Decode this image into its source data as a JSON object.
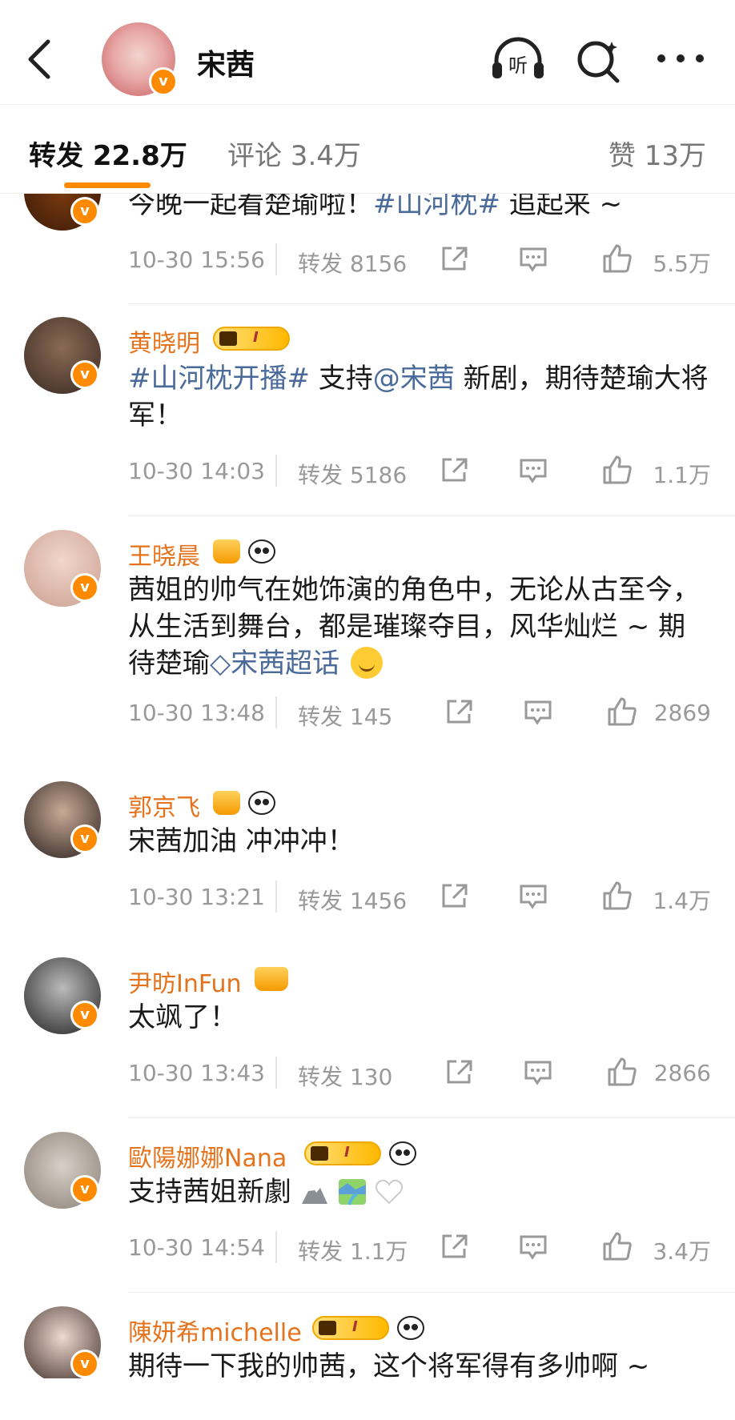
{
  "header": {
    "title": "宋茜"
  },
  "tabs": {
    "repost": "转发 22.8万",
    "comments": "评论 3.4万",
    "likes": "赞 13万"
  },
  "posts": [
    {
      "text": "今晚一起看楚瑜啦！",
      "link": "#山河枕#",
      "text2": " 追起来 ~",
      "time": "10-30 15:56",
      "reposts": "转发 8156",
      "likes": "5.5万"
    },
    {
      "name": "黄晓明",
      "link1": "#山河枕开播#",
      "text1": " 支持",
      "link2": "@宋茜",
      "text2": " 新剧，期待楚瑜大将军！",
      "time": "10-30 14:03",
      "reposts": "转发 5186",
      "likes": "1.1万"
    },
    {
      "name": "王晓晨",
      "text": "茜姐的帅气在她饰演的角色中，无论从古至今，从生活到舞台，都是璀璨夺目，风华灿烂 ~ 期待楚瑜",
      "link": "宋茜超话",
      "time": "10-30 13:48",
      "reposts": "转发 145",
      "likes": "2869"
    },
    {
      "name": "郭京飞",
      "text": "宋茜加油 冲冲冲！",
      "time": "10-30 13:21",
      "reposts": "转发 1456",
      "likes": "1.4万"
    },
    {
      "name": "尹昉InFun",
      "text": "太飒了！",
      "time": "10-30 13:43",
      "reposts": "转发 130",
      "likes": "2866"
    },
    {
      "name": "歐陽娜娜Nana",
      "text": "支持茜姐新劇",
      "time": "10-30 14:54",
      "reposts": "转发 1.1万",
      "likes": "3.4万"
    },
    {
      "name": "陳妍希michelle",
      "text": "期待一下我的帅茜，这个将军得有多帅啊 ~"
    }
  ],
  "badge_tag": "I",
  "verified_mark": "v",
  "colors": {
    "accent": "#ff8a00",
    "name": "#e5731d",
    "link": "#4a6a9a",
    "meta": "#999999"
  }
}
